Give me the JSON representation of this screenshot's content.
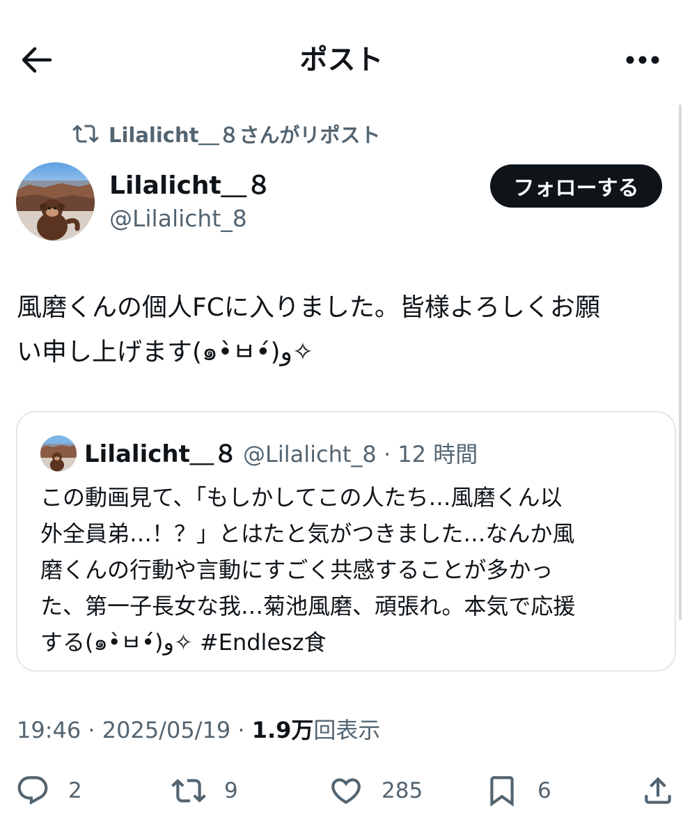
{
  "header": {
    "title": "ポスト"
  },
  "repost": {
    "label": "Lilalicht＿８さんがリポスト"
  },
  "author": {
    "name": "Lilalicht＿８",
    "handle": "@Lilalicht_8",
    "follow_label": "フォローする"
  },
  "post": {
    "text": "風磨くんの個人FCに入りました。皆様よろしくお願\nい申し上げます(๑•̀ㅂ•́)و✧"
  },
  "quote": {
    "name": "Lilalicht＿８",
    "meta": "@Lilalicht_8 · 12 時間",
    "lines": [
      "この動画見て、「もしかしてこの人たち…風磨くん以",
      "外全員弟…！？」とはたと気がつきました…なんか風",
      "磨くんの行動や言動にすごく共感することが多かっ",
      "た、第一子長女な我…菊池風磨、頑張れ。本気で応援",
      "する(๑•̀ㅂ•́)و✧  #Endlesz食"
    ]
  },
  "timestamp": {
    "time": "19:46 · 2025/05/19 · ",
    "views_count": "1.9万",
    "views_label": "回表示"
  },
  "actions": {
    "reply_count": "2",
    "repost_count": "9",
    "like_count": "285",
    "bookmark_count": "6"
  },
  "icons": {
    "back": "arrow-left-icon",
    "more": "more-dots-icon",
    "repost": "repost-icon",
    "reply": "reply-bubble-icon",
    "like": "heart-icon",
    "bookmark": "bookmark-icon",
    "share": "share-icon"
  },
  "colors": {
    "text": "#0f1419",
    "secondary": "#536471",
    "border": "#e1e6ea",
    "follow_bg": "#0f1419"
  }
}
